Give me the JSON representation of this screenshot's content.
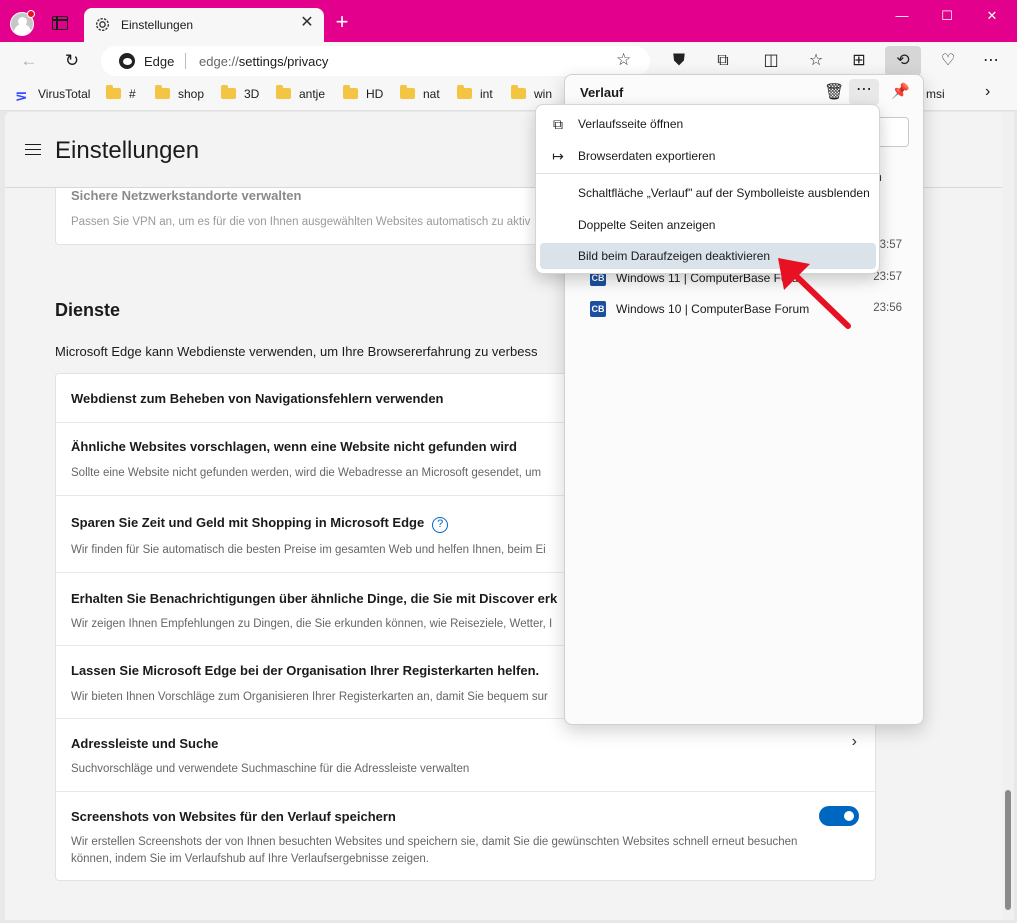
{
  "browser": {
    "tab_title": "Einstellungen",
    "address": {
      "brand": "Edge",
      "url_prefix": "edge://",
      "url_rest": "settings/privacy"
    },
    "bookmarks": [
      "VirusTotal",
      "#",
      "shop",
      "3D",
      "antje",
      "HD",
      "nat",
      "int",
      "win",
      "msi"
    ],
    "window_buttons": [
      "—",
      "☐",
      "✕"
    ]
  },
  "settings": {
    "page_title": "Einstellungen",
    "top_card": {
      "title": "Sichere Netzwerkstandorte verwalten",
      "desc": "Passen Sie VPN an, um es für die von Ihnen ausgewählten Websites automatisch zu aktiv"
    },
    "section": {
      "title": "Dienste",
      "desc": "Microsoft Edge kann Webdienste verwenden, um Ihre Browsererfahrung zu verbess"
    },
    "items": [
      {
        "title": "Webdienst zum Beheben von Navigationsfehlern verwenden",
        "desc": ""
      },
      {
        "title": "Ähnliche Websites vorschlagen, wenn eine Website nicht gefunden wird",
        "desc": "Sollte eine Website nicht gefunden werden, wird die Webadresse an Microsoft gesendet, um"
      },
      {
        "title": "Sparen Sie Zeit und Geld mit Shopping in Microsoft Edge",
        "desc": "Wir finden für Sie automatisch die besten Preise im gesamten Web und helfen Ihnen, beim Ei"
      },
      {
        "title": "Erhalten Sie Benachrichtigungen über ähnliche Dinge, die Sie mit Discover erk",
        "desc": "Wir zeigen Ihnen Empfehlungen zu Dingen, die Sie erkunden können, wie Reiseziele, Wetter, I"
      },
      {
        "title": "Lassen Sie Microsoft Edge bei der Organisation Ihrer Registerkarten helfen.",
        "desc": "Wir bieten Ihnen Vorschläge zum Organisieren Ihrer Registerkarten an, damit Sie bequem sur"
      },
      {
        "title": "Adressleiste und Suche",
        "desc": "Suchvorschläge und verwendete Suchmaschine für die Adressleiste verwalten"
      },
      {
        "title": "Screenshots von Websites für den Verlauf speichern",
        "desc_line1": "Wir erstellen Screenshots der von Ihnen besuchten Websites und speichern sie, damit Sie die gewünschten Websites schnell erneut besuchen",
        "desc_line2": "können, indem Sie im Verlaufshub auf Ihre Verlaufsergebnisse zeigen.",
        "toggle_on": true
      }
    ]
  },
  "history": {
    "title": "Verlauf",
    "tab_fragment": "en",
    "entries": [
      {
        "name": "",
        "time": "23:57"
      },
      {
        "name": "Windows 11 | ComputerBase Foru",
        "time": "23:57"
      },
      {
        "name": "Windows 10 | ComputerBase Forum",
        "time": "23:56"
      }
    ]
  },
  "context_menu": {
    "items": [
      {
        "label": "Verlaufsseite öffnen",
        "icon": "open-external-icon"
      },
      {
        "label": "Browserdaten exportieren",
        "icon": "export-arrow-icon"
      },
      {
        "label": "Schaltfläche „Verlauf\" auf der Symbolleiste ausblenden",
        "icon": ""
      },
      {
        "label": "Doppelte Seiten anzeigen",
        "icon": ""
      },
      {
        "label": "Bild beim Daraufzeigen deaktivieren",
        "icon": ""
      }
    ],
    "highlighted_index": 4
  },
  "colors": {
    "titlebar": "#e3008c",
    "accent": "#0067c0",
    "arrow": "#e81123"
  }
}
